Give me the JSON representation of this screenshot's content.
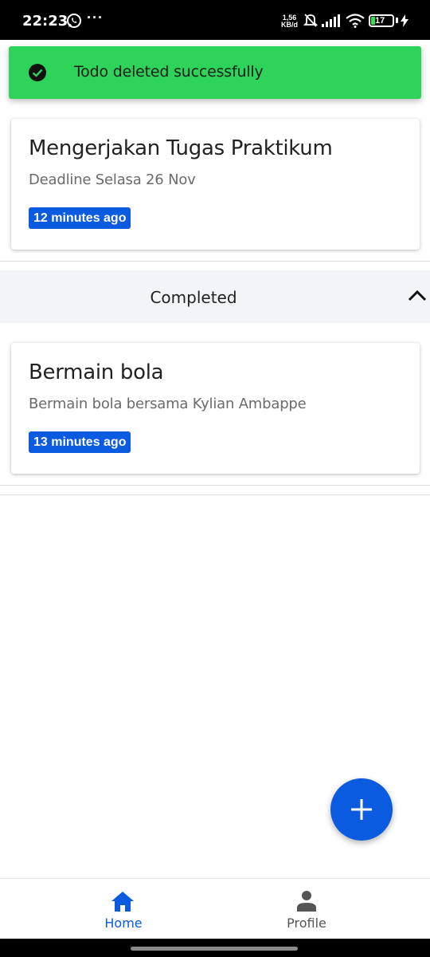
{
  "status_bar": {
    "time": "22:23",
    "speed_value": "1,56",
    "speed_unit": "KB/d",
    "battery": "17",
    "icons": [
      "whatsapp-icon",
      "more-dots-icon",
      "mute-bell-icon",
      "signal-icon",
      "wifi-icon",
      "battery-icon",
      "charging-bolt-icon"
    ]
  },
  "toast": {
    "message": "Todo deleted successfully",
    "icon": "check-circle-icon",
    "color": "#2ed45a"
  },
  "todo_items": [
    {
      "title": "Mengerjakan Tugas Praktikum",
      "description": "Deadline Selasa 26 Nov",
      "time_ago": "12 minutes ago"
    }
  ],
  "completed_section": {
    "title": "Completed",
    "icon": "chevron-up-icon",
    "items": [
      {
        "title": "Bermain bola",
        "description": "Bermain bola bersama Kylian Ambappe",
        "time_ago": "13 minutes ago"
      }
    ]
  },
  "fab": {
    "icon": "plus-icon",
    "color": "#0a5be0"
  },
  "bottom_nav": {
    "items": [
      {
        "label": "Home",
        "icon": "home-icon",
        "active": true,
        "color": "#0a5be0"
      },
      {
        "label": "Profile",
        "icon": "person-icon",
        "active": false,
        "color": "#555555"
      }
    ]
  },
  "accent_color": "#0a5be0"
}
